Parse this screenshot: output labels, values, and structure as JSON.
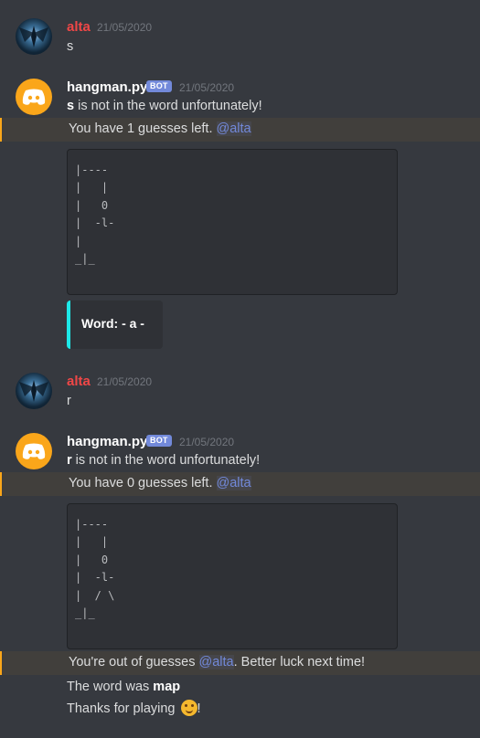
{
  "messages": [
    {
      "author": "alta",
      "time": "21/05/2020",
      "text": "s"
    },
    {
      "author": "hangman.py",
      "tag": "BOT",
      "time": "21/05/2020",
      "line1_bold": "s",
      "line1_rest": " is not in the word unfortunately!",
      "mention_text": "You have 1 guesses left. ",
      "mention": "@alta",
      "hangman": "|----\n|   |\n|   0\n|  -l-\n|\n_|_",
      "embed_label": "Word:",
      "embed_value": " - a -"
    },
    {
      "author": "alta",
      "time": "21/05/2020",
      "text": "r"
    },
    {
      "author": "hangman.py",
      "tag": "BOT",
      "time": "21/05/2020",
      "line1_bold": "r",
      "line1_rest": " is not in the word unfortunately!",
      "mention_text": "You have 0 guesses left. ",
      "mention": "@alta",
      "hangman": "|----\n|   |\n|   0\n|  -l-\n|  / \\\n_|_",
      "out_text1": "You're out of guesses ",
      "out_mention": "@alta",
      "out_text2": ". Better luck next time!",
      "word_text": "The word was ",
      "word_bold": "map",
      "thanks_text": "Thanks for playing ",
      "thanks_end": "!"
    }
  ]
}
